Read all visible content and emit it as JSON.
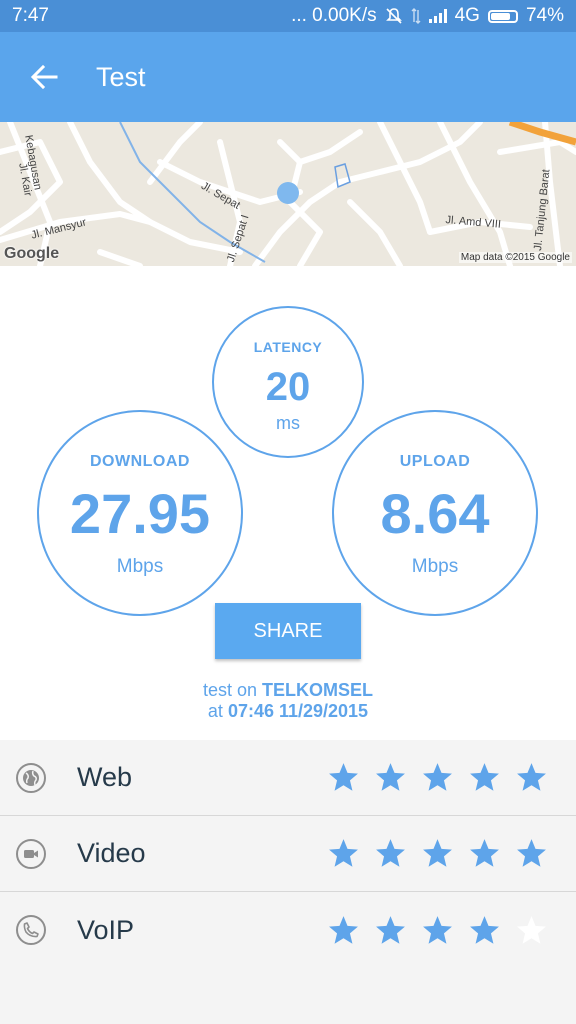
{
  "status_bar": {
    "time": "7:47",
    "network_speed": "... 0.00K/s",
    "network_type": "4G",
    "battery": "74%"
  },
  "app_bar": {
    "back_icon": "arrow-left-icon",
    "title": "Test"
  },
  "map": {
    "street_labels": [
      "Kebagusan",
      "Jl. Kair",
      "Jl. Sepat",
      "Jl. Mansyur",
      "Jl. Sepat I",
      "Jl. Amd VIII",
      "Jl. Tanjung Barat"
    ],
    "logo": "Google",
    "attribution": "Map data ©2015 Google"
  },
  "latency": {
    "label": "LATENCY",
    "value": "20",
    "unit": "ms"
  },
  "download": {
    "label": "DOWNLOAD",
    "value": "27.95",
    "unit": "Mbps"
  },
  "upload": {
    "label": "UPLOAD",
    "value": "8.64",
    "unit": "Mbps"
  },
  "share_label": "SHARE",
  "test_info": {
    "prefix": "test on",
    "operator": "TELKOMSEL",
    "at": "at",
    "datetime": "07:46 11/29/2015"
  },
  "ratings": [
    {
      "label": "Web",
      "icon": "globe-icon",
      "stars": 5,
      "max": 5
    },
    {
      "label": "Video",
      "icon": "video-camera-icon",
      "stars": 5,
      "max": 5
    },
    {
      "label": "VoIP",
      "icon": "phone-icon",
      "stars": 4,
      "max": 5
    }
  ],
  "colors": {
    "accent": "#5ea4ea",
    "app_bar": "#5aa5ec",
    "status_bar": "#4a8fd6",
    "star_on": "#5ea4ea",
    "star_off": "#ffffff"
  }
}
